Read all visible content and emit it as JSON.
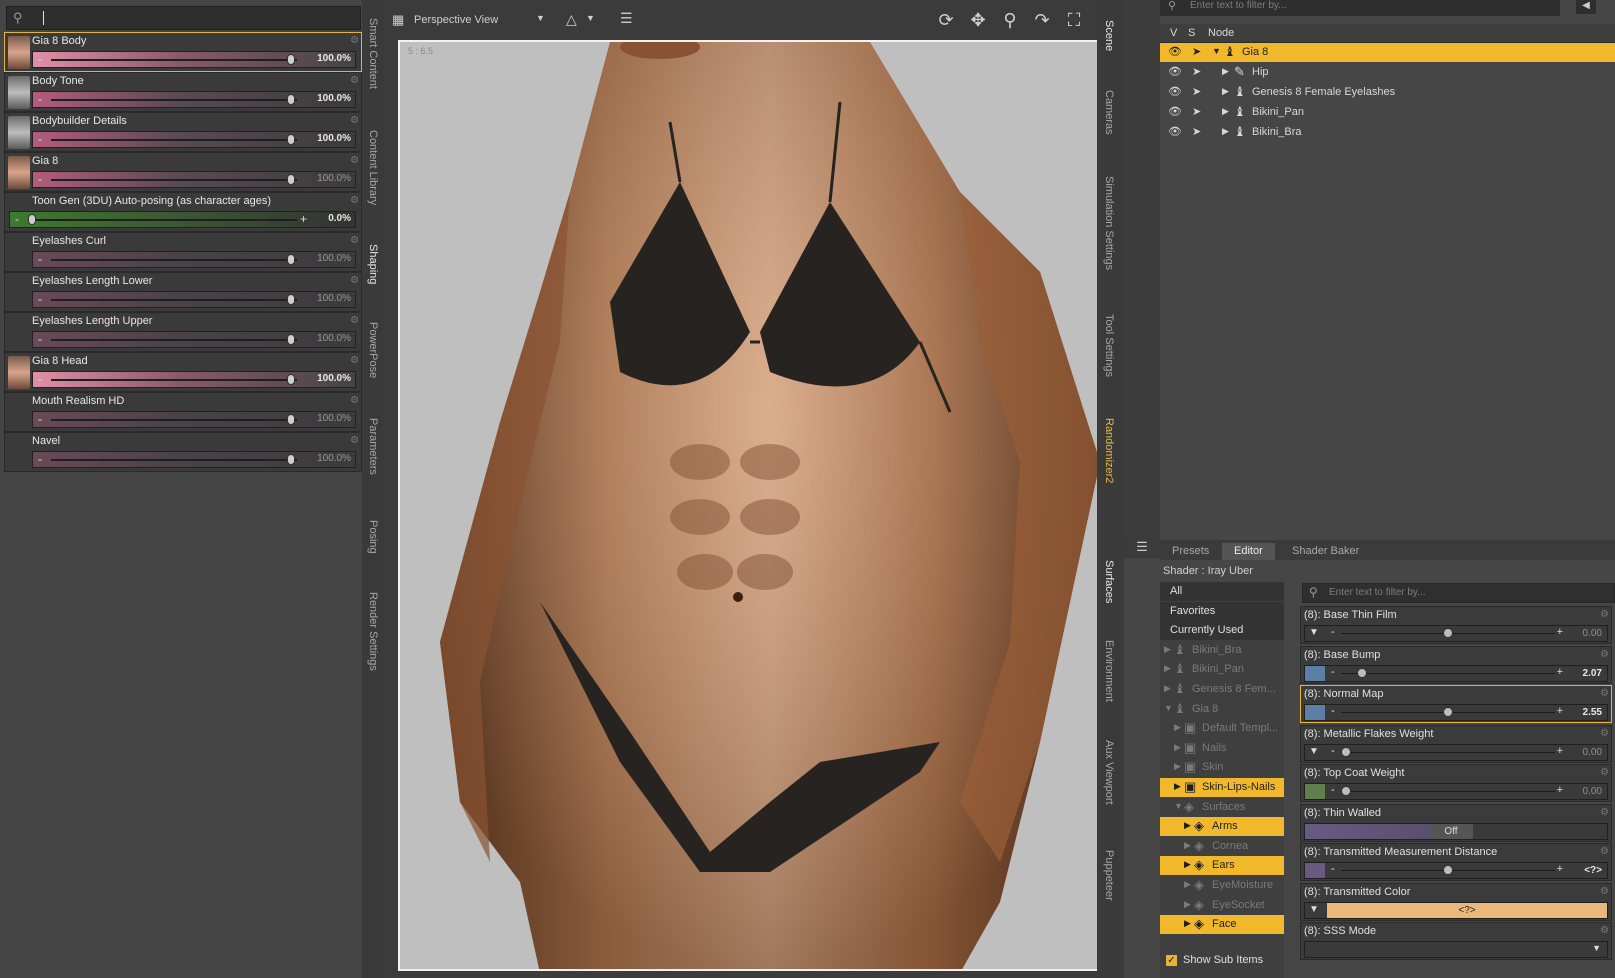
{
  "left_panel": {
    "search_value": "",
    "morphs": [
      {
        "label": "Gia 8 Body",
        "value": "100.0%",
        "level": 1.0,
        "has_thumb": true,
        "thumb": "color",
        "style": "bright",
        "selected": true,
        "dim": false
      },
      {
        "label": "Body Tone",
        "value": "100.0%",
        "level": 1.0,
        "has_thumb": true,
        "thumb": "gray",
        "style": "normal",
        "selected": false,
        "dim": false
      },
      {
        "label": "Bodybuilder Details",
        "value": "100.0%",
        "level": 1.0,
        "has_thumb": true,
        "thumb": "gray",
        "style": "normal",
        "selected": false,
        "dim": false
      },
      {
        "label": "Gia 8",
        "value": "100.0%",
        "level": 1.0,
        "has_thumb": true,
        "thumb": "color",
        "style": "normal",
        "selected": false,
        "dim": true
      },
      {
        "label": "Toon Gen (3DU) Auto-posing (as character ages)",
        "value": "0.0%",
        "level": 0.0,
        "has_thumb": false,
        "thumb": "",
        "style": "green",
        "selected": false,
        "dim": false
      },
      {
        "label": "Eyelashes Curl",
        "value": "100.0%",
        "level": 1.0,
        "has_thumb": false,
        "thumb": "",
        "style": "dim",
        "selected": false,
        "dim": true
      },
      {
        "label": "Eyelashes Length Lower",
        "value": "100.0%",
        "level": 1.0,
        "has_thumb": false,
        "thumb": "",
        "style": "dim",
        "selected": false,
        "dim": true
      },
      {
        "label": "Eyelashes Length Upper",
        "value": "100.0%",
        "level": 1.0,
        "has_thumb": false,
        "thumb": "",
        "style": "dim",
        "selected": false,
        "dim": true
      },
      {
        "label": "Gia 8 Head",
        "value": "100.0%",
        "level": 1.0,
        "has_thumb": true,
        "thumb": "color",
        "style": "bright",
        "selected": false,
        "dim": false
      },
      {
        "label": "Mouth Realism HD",
        "value": "100.0%",
        "level": 1.0,
        "has_thumb": false,
        "thumb": "",
        "style": "dim",
        "selected": false,
        "dim": true
      },
      {
        "label": "Navel",
        "value": "100.0%",
        "level": 1.0,
        "has_thumb": false,
        "thumb": "",
        "style": "dim",
        "selected": false,
        "dim": true
      }
    ]
  },
  "left_tabs": [
    "Smart Content",
    "Content Library",
    "Shaping",
    "PowerPose",
    "Parameters",
    "Posing",
    "Render Settings"
  ],
  "left_tabs_active": "Shaping",
  "viewport": {
    "view_name": "Perspective View",
    "scale_label": "5 : 6.5",
    "tool_icons": [
      "orbit-icon",
      "pan-icon",
      "zoom-icon",
      "rotate-icon",
      "frame-icon",
      "home-icon"
    ]
  },
  "right_tabs_top": [
    "Scene",
    "Cameras",
    "Simulation Settings",
    "Tool Settings",
    "Randomizer2"
  ],
  "right_tabs_bottom": [
    "Surfaces",
    "Environment",
    "Aux Viewport",
    "Puppeteer"
  ],
  "scene": {
    "filter_placeholder": "Enter text to filter by...",
    "headers": {
      "v": "V",
      "s": "S",
      "node": "Node"
    },
    "nodes": [
      {
        "label": "Gia 8",
        "indent": 0,
        "expanded": true,
        "icon": "figure-icon",
        "selected": true
      },
      {
        "label": "Hip",
        "indent": 1,
        "expanded": false,
        "icon": "bone-icon",
        "selected": false
      },
      {
        "label": "Genesis 8 Female Eyelashes",
        "indent": 1,
        "expanded": false,
        "icon": "figure-icon",
        "selected": false
      },
      {
        "label": "Bikini_Pan",
        "indent": 1,
        "expanded": false,
        "icon": "figure-icon",
        "selected": false
      },
      {
        "label": "Bikini_Bra",
        "indent": 1,
        "expanded": false,
        "icon": "figure-icon",
        "selected": false
      }
    ]
  },
  "surfaces": {
    "tabs": [
      "Presets",
      "Editor",
      "Shader Baker"
    ],
    "active_tab": "Editor",
    "shader": "Shader : Iray Uber",
    "filter_placeholder": "Enter text to filter by...",
    "tree": [
      {
        "label": "All",
        "indent": 0,
        "arrow": "",
        "icon": "",
        "state": "filter"
      },
      {
        "label": "Favorites",
        "indent": 0,
        "arrow": "",
        "icon": "",
        "state": "filter"
      },
      {
        "label": "Currently Used",
        "indent": 0,
        "arrow": "",
        "icon": "",
        "state": "filter"
      },
      {
        "label": "Bikini_Bra",
        "indent": 0,
        "arrow": "▶",
        "icon": "figure-icon",
        "state": "dim"
      },
      {
        "label": "Bikini_Pan",
        "indent": 0,
        "arrow": "▶",
        "icon": "figure-icon",
        "state": "dim"
      },
      {
        "label": "Genesis 8 Fem...",
        "indent": 0,
        "arrow": "▶",
        "icon": "figure-icon",
        "state": "dim"
      },
      {
        "label": "Gia 8",
        "indent": 0,
        "arrow": "▼",
        "icon": "figure-icon",
        "state": "dim"
      },
      {
        "label": "Default Templ...",
        "indent": 1,
        "arrow": "▶",
        "icon": "material-group-icon",
        "state": "dim"
      },
      {
        "label": "Nails",
        "indent": 1,
        "arrow": "▶",
        "icon": "material-group-icon",
        "state": "dim"
      },
      {
        "label": "Skin",
        "indent": 1,
        "arrow": "▶",
        "icon": "material-group-icon",
        "state": "dim"
      },
      {
        "label": "Skin-Lips-Nails",
        "indent": 1,
        "arrow": "▶",
        "icon": "material-group-icon",
        "state": "hi"
      },
      {
        "label": "Surfaces",
        "indent": 1,
        "arrow": "▼",
        "icon": "surface-icon",
        "state": "dim"
      },
      {
        "label": "Arms",
        "indent": 2,
        "arrow": "▶",
        "icon": "surface-icon",
        "state": "hi"
      },
      {
        "label": "Cornea",
        "indent": 2,
        "arrow": "▶",
        "icon": "surface-icon",
        "state": "dim"
      },
      {
        "label": "Ears",
        "indent": 2,
        "arrow": "▶",
        "icon": "surface-icon",
        "state": "hi"
      },
      {
        "label": "EyeMoisture",
        "indent": 2,
        "arrow": "▶",
        "icon": "surface-icon",
        "state": "dim"
      },
      {
        "label": "EyeSocket",
        "indent": 2,
        "arrow": "▶",
        "icon": "surface-icon",
        "state": "dim"
      },
      {
        "label": "Face",
        "indent": 2,
        "arrow": "▶",
        "icon": "surface-icon",
        "state": "hi"
      }
    ],
    "show_sub_items": "Show Sub Items",
    "properties": [
      {
        "label": "(8): Base Thin Film",
        "value": "0.00",
        "level": 0.5,
        "swatch": "#3a3a3a",
        "kind": "slider",
        "dropdown": true,
        "dim": true,
        "selected": false
      },
      {
        "label": "(8): Base Bump",
        "value": "2.07",
        "level": 0.08,
        "swatch": "#5d7fa6",
        "kind": "slider",
        "dropdown": false,
        "dim": false,
        "selected": false
      },
      {
        "label": "(8): Normal Map",
        "value": "2.55",
        "level": 0.5,
        "swatch": "#5d7fa6",
        "kind": "slider",
        "dropdown": false,
        "dim": false,
        "selected": true
      },
      {
        "label": "(8): Metallic Flakes Weight",
        "value": "0.00",
        "level": 0.0,
        "swatch": "#3a3a3a",
        "kind": "slider",
        "dropdown": true,
        "dim": true,
        "selected": false
      },
      {
        "label": "(8): Top Coat Weight",
        "value": "0.00",
        "level": 0.0,
        "swatch": "#5f7f4f",
        "kind": "slider",
        "dropdown": false,
        "dim": true,
        "selected": false
      },
      {
        "label": "(8): Thin Walled",
        "value": "Off",
        "level": 0.0,
        "swatch": "#6a5a82",
        "kind": "toggle",
        "dropdown": false,
        "dim": false,
        "selected": false
      },
      {
        "label": "(8): Transmitted Measurement Distance",
        "value": "<?>",
        "level": 0.5,
        "swatch": "#6a5a82",
        "kind": "slider",
        "dropdown": false,
        "dim": false,
        "selected": false
      },
      {
        "label": "(8): Transmitted Color",
        "value": "<?>",
        "level": 0.0,
        "swatch": "#e9b87a",
        "kind": "color",
        "dropdown": true,
        "dim": false,
        "selected": false
      },
      {
        "label": "(8): SSS Mode",
        "value": "",
        "level": 0.0,
        "swatch": "#3a3a3a",
        "kind": "select",
        "dropdown": false,
        "dim": false,
        "selected": false
      }
    ]
  },
  "colors": {
    "accent": "#f1b82b",
    "panel": "#454545",
    "viewport_bg": "#bfbfbf"
  }
}
